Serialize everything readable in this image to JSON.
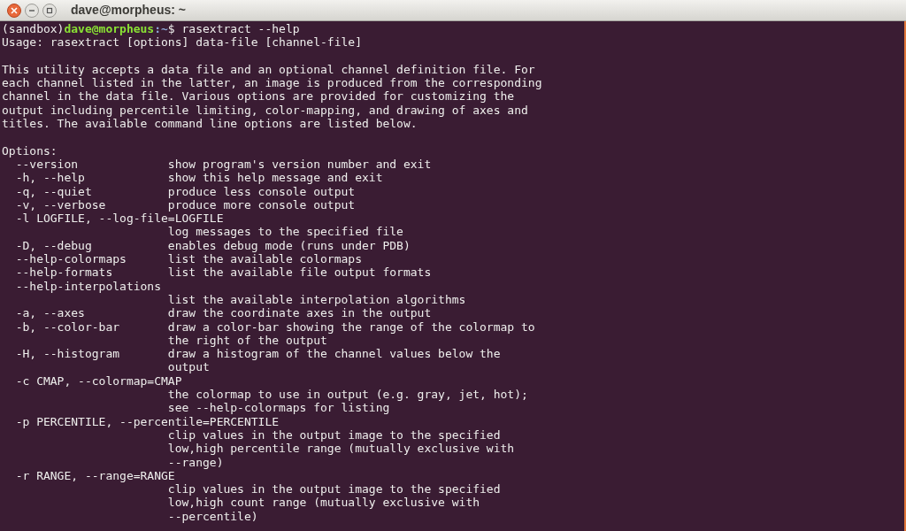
{
  "window": {
    "title": "dave@morpheus: ~"
  },
  "terminal": {
    "lines": [
      {
        "kind": "prompt",
        "env": "(sandbox)",
        "user_host": "dave@morpheus",
        "path": ":~",
        "command": "$ rasextract --help"
      },
      {
        "kind": "text",
        "text": "Usage: rasextract [options] data-file [channel-file]"
      },
      {
        "kind": "blank"
      },
      {
        "kind": "text",
        "text": "This utility accepts a data file and an optional channel definition file. For"
      },
      {
        "kind": "text",
        "text": "each channel listed in the latter, an image is produced from the corresponding"
      },
      {
        "kind": "text",
        "text": "channel in the data file. Various options are provided for customizing the"
      },
      {
        "kind": "text",
        "text": "output including percentile limiting, color-mapping, and drawing of axes and"
      },
      {
        "kind": "text",
        "text": "titles. The available command line options are listed below."
      },
      {
        "kind": "blank"
      },
      {
        "kind": "text",
        "text": "Options:"
      },
      {
        "kind": "text",
        "text": "  --version             show program's version number and exit"
      },
      {
        "kind": "text",
        "text": "  -h, --help            show this help message and exit"
      },
      {
        "kind": "text",
        "text": "  -q, --quiet           produce less console output"
      },
      {
        "kind": "text",
        "text": "  -v, --verbose         produce more console output"
      },
      {
        "kind": "text",
        "text": "  -l LOGFILE, --log-file=LOGFILE"
      },
      {
        "kind": "text",
        "text": "                        log messages to the specified file"
      },
      {
        "kind": "text",
        "text": "  -D, --debug           enables debug mode (runs under PDB)"
      },
      {
        "kind": "text",
        "text": "  --help-colormaps      list the available colormaps"
      },
      {
        "kind": "text",
        "text": "  --help-formats        list the available file output formats"
      },
      {
        "kind": "text",
        "text": "  --help-interpolations"
      },
      {
        "kind": "text",
        "text": "                        list the available interpolation algorithms"
      },
      {
        "kind": "text",
        "text": "  -a, --axes            draw the coordinate axes in the output"
      },
      {
        "kind": "text",
        "text": "  -b, --color-bar       draw a color-bar showing the range of the colormap to"
      },
      {
        "kind": "text",
        "text": "                        the right of the output"
      },
      {
        "kind": "text",
        "text": "  -H, --histogram       draw a histogram of the channel values below the"
      },
      {
        "kind": "text",
        "text": "                        output"
      },
      {
        "kind": "text",
        "text": "  -c CMAP, --colormap=CMAP"
      },
      {
        "kind": "text",
        "text": "                        the colormap to use in output (e.g. gray, jet, hot);"
      },
      {
        "kind": "text",
        "text": "                        see --help-colormaps for listing"
      },
      {
        "kind": "text",
        "text": "  -p PERCENTILE, --percentile=PERCENTILE"
      },
      {
        "kind": "text",
        "text": "                        clip values in the output image to the specified"
      },
      {
        "kind": "text",
        "text": "                        low,high percentile range (mutually exclusive with"
      },
      {
        "kind": "text",
        "text": "                        --range)"
      },
      {
        "kind": "text",
        "text": "  -r RANGE, --range=RANGE"
      },
      {
        "kind": "text",
        "text": "                        clip values in the output image to the specified"
      },
      {
        "kind": "text",
        "text": "                        low,high count range (mutually exclusive with"
      },
      {
        "kind": "text",
        "text": "                        --percentile)"
      }
    ]
  }
}
